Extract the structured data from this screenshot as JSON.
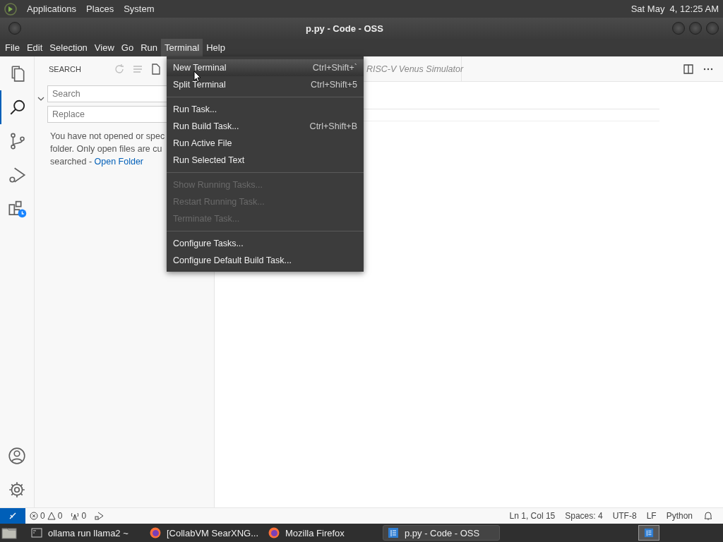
{
  "top_panel": {
    "menus": [
      "Applications",
      "Places",
      "System"
    ],
    "clock": "Sat May  4, 12:25 AM"
  },
  "window": {
    "title": "p.py - Code - OSS"
  },
  "menu_bar": [
    {
      "label": "File",
      "selected": false
    },
    {
      "label": "Edit",
      "selected": false
    },
    {
      "label": "Selection",
      "selected": false
    },
    {
      "label": "View",
      "selected": false
    },
    {
      "label": "Go",
      "selected": false
    },
    {
      "label": "Run",
      "selected": false
    },
    {
      "label": "Terminal",
      "selected": true
    },
    {
      "label": "Help",
      "selected": false
    }
  ],
  "activity_bar": [
    {
      "kind": "files",
      "selected": false
    },
    {
      "kind": "search",
      "selected": true
    },
    {
      "kind": "scm",
      "selected": false
    },
    {
      "kind": "debug",
      "selected": false
    },
    {
      "kind": "extensions",
      "selected": false
    }
  ],
  "sidebar": {
    "title": "SEARCH",
    "search": {
      "placeholder": "Search"
    },
    "replace": {
      "placeholder": "Replace"
    },
    "message": "You have not opened or spec",
    "message_2": "folder. Only open files are cu",
    "message_3": "searched - ",
    "link": "Open Folder"
  },
  "editor": {
    "tab": "RISC-V Venus Simulator"
  },
  "terminal_menu": [
    {
      "kind": "item",
      "label": "New Terminal",
      "shortcut": "Ctrl+Shift+`",
      "disabled": false,
      "selected": true
    },
    {
      "kind": "item",
      "label": "Split Terminal",
      "shortcut": "Ctrl+Shift+5",
      "disabled": false,
      "selected": false
    },
    {
      "kind": "separator"
    },
    {
      "kind": "item",
      "label": "Run Task...",
      "disabled": false,
      "selected": false
    },
    {
      "kind": "item",
      "label": "Run Build Task...",
      "shortcut": "Ctrl+Shift+B",
      "disabled": false,
      "selected": false
    },
    {
      "kind": "item",
      "label": "Run Active File",
      "disabled": false,
      "selected": false
    },
    {
      "kind": "item",
      "label": "Run Selected Text",
      "disabled": false,
      "selected": false
    },
    {
      "kind": "separator"
    },
    {
      "kind": "item",
      "label": "Show Running Tasks...",
      "disabled": true,
      "selected": false
    },
    {
      "kind": "item",
      "label": "Restart Running Task...",
      "disabled": true,
      "selected": false
    },
    {
      "kind": "item",
      "label": "Terminate Task...",
      "disabled": true,
      "selected": false
    },
    {
      "kind": "separator"
    },
    {
      "kind": "item",
      "label": "Configure Tasks...",
      "disabled": false,
      "selected": false
    },
    {
      "kind": "item",
      "label": "Configure Default Build Task...",
      "disabled": false,
      "selected": false
    }
  ],
  "status_bar": {
    "errors": "0",
    "warnings": "0",
    "ports": "0",
    "right": [
      "Ln 1, Col 15",
      "Spaces: 4",
      "UTF-8",
      "LF",
      "Python"
    ]
  },
  "taskbar": [
    {
      "kind": "terminal",
      "label": "ollama run llama2 ~",
      "selected": false
    },
    {
      "kind": "firefox",
      "label": "[CollabVM SearXNG...",
      "selected": false
    },
    {
      "kind": "firefox",
      "label": "Mozilla Firefox",
      "selected": false
    },
    {
      "kind": "code",
      "label": "p.py - Code - OSS",
      "selected": true
    }
  ]
}
